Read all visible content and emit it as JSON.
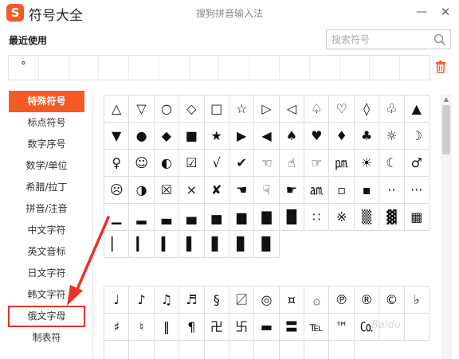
{
  "window": {
    "app_title": "符号大全",
    "subtitle": "搜狗拼音输入法",
    "logo_letter": "S",
    "minimize_symbol": "—",
    "close_symbol": "✕"
  },
  "recent": {
    "label": "最近使用",
    "items": [
      "°",
      "",
      "",
      "",
      "",
      "",
      "",
      "",
      "",
      "",
      "",
      "",
      "",
      ""
    ]
  },
  "search": {
    "placeholder": "搜索符号",
    "icon": "search-icon"
  },
  "sidebar": {
    "items": [
      {
        "label": "特殊符号"
      },
      {
        "label": "标点符号"
      },
      {
        "label": "数字序号"
      },
      {
        "label": "数学/单位"
      },
      {
        "label": "希腊/拉丁"
      },
      {
        "label": "拼音/注音"
      },
      {
        "label": "中文字符"
      },
      {
        "label": "英文音标"
      },
      {
        "label": "日文字符"
      },
      {
        "label": "韩文字符"
      },
      {
        "label": "俄文字母"
      },
      {
        "label": "制表符"
      }
    ],
    "active_index": 0,
    "highlighted_index": 10
  },
  "grid1": [
    "△",
    "▽",
    "○",
    "◇",
    "□",
    "☆",
    "▷",
    "◁",
    "♤",
    "♡",
    "◊",
    "♧",
    "▲",
    "▼",
    "●",
    "◆",
    "■",
    "★",
    "▶",
    "◀",
    "♠",
    "♥",
    "♦",
    "♣",
    "☼",
    "☽",
    "♀",
    "☺",
    "◐",
    "☑",
    "√",
    "✔",
    "☜",
    "☝",
    "☞",
    "㏘",
    "☀",
    "☾",
    "♂",
    "☹",
    "◑",
    "☒",
    "×",
    "✘",
    "☚",
    "☟",
    "☛",
    "㏂",
    "▫",
    "▪",
    "··",
    "···",
    "▁",
    "▂",
    "▃",
    "▄",
    "▅",
    "▆",
    "▇",
    "█",
    "∷",
    "※",
    "▒",
    "▓",
    "▦",
    "▏",
    "▎",
    "▍",
    "▌",
    "▋",
    "▊",
    "▉"
  ],
  "grid2": [
    "♩",
    "♪",
    "♫",
    "♬",
    "§",
    "〼",
    "◎",
    "¤",
    "۞",
    "℗",
    "®",
    "©",
    "♭",
    "♯",
    "♮",
    "‖",
    "¶",
    "卍",
    "卐",
    "▬",
    "〓",
    "℡",
    "™",
    "㏇",
    "",
    "",
    "",
    "",
    "",
    "",
    "",
    "",
    "",
    "",
    "",
    ""
  ],
  "colors": {
    "accent": "#f45a24",
    "highlight_box": "#e8322a",
    "arrow": "#e8322a"
  },
  "watermark": "Baidu"
}
